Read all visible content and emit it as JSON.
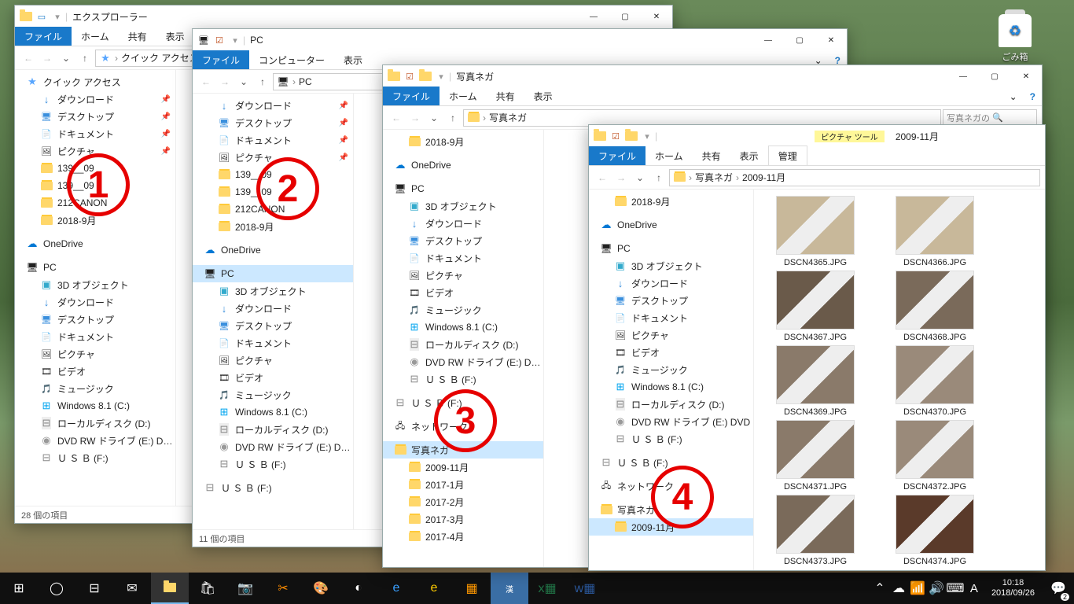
{
  "desktop": {
    "recycle_bin": "ごみ箱"
  },
  "overlay": {
    "1": "1",
    "2": "2",
    "3": "3",
    "4": "4"
  },
  "titlebar_title_extra": "2009-11月",
  "tabs": {
    "file": "ファイル",
    "home": "ホーム",
    "share": "共有",
    "view": "表示",
    "computer": "コンピューター",
    "tool_ctx": "ピクチャ ツール",
    "tool_manage": "管理"
  },
  "ui": {
    "search_prefix": "写真ネガの"
  },
  "w1": {
    "title": "エクスプローラー",
    "breadcrumb": [
      "クイック アクセス"
    ],
    "status": "28 個の項目",
    "nav": [
      {
        "lbl": "クイック アクセス",
        "ico": "i-star",
        "ind": 0
      },
      {
        "lbl": "ダウンロード",
        "ico": "i-dl",
        "ind": 1,
        "pin": 1
      },
      {
        "lbl": "デスクトップ",
        "ico": "i-desk",
        "ind": 1,
        "pin": 1
      },
      {
        "lbl": "ドキュメント",
        "ico": "i-doc",
        "ind": 1,
        "pin": 1
      },
      {
        "lbl": "ピクチャ",
        "ico": "i-pic",
        "ind": 1,
        "pin": 1
      },
      {
        "lbl": "139__09",
        "ico": "i-fold",
        "ind": 1
      },
      {
        "lbl": "139__09",
        "ico": "i-fold",
        "ind": 1
      },
      {
        "lbl": "212CANON",
        "ico": "i-fold",
        "ind": 1
      },
      {
        "lbl": "2018-9月",
        "ico": "i-fold",
        "ind": 1
      },
      {
        "lbl": "",
        "spacer": 1
      },
      {
        "lbl": "OneDrive",
        "ico": "i-od",
        "ind": 0
      },
      {
        "lbl": "",
        "spacer": 1
      },
      {
        "lbl": "PC",
        "ico": "i-pc",
        "ind": 0
      },
      {
        "lbl": "3D オブジェクト",
        "ico": "i-3d",
        "ind": 1
      },
      {
        "lbl": "ダウンロード",
        "ico": "i-dl",
        "ind": 1
      },
      {
        "lbl": "デスクトップ",
        "ico": "i-desk",
        "ind": 1
      },
      {
        "lbl": "ドキュメント",
        "ico": "i-doc",
        "ind": 1
      },
      {
        "lbl": "ピクチャ",
        "ico": "i-pic",
        "ind": 1
      },
      {
        "lbl": "ビデオ",
        "ico": "i-vid",
        "ind": 1
      },
      {
        "lbl": "ミュージック",
        "ico": "i-mus",
        "ind": 1
      },
      {
        "lbl": "Windows 8.1 (C:)",
        "ico": "i-win",
        "ind": 1
      },
      {
        "lbl": "ローカルディスク (D:)",
        "ico": "i-drive",
        "ind": 1
      },
      {
        "lbl": "DVD RW ドライブ (E:) DVD",
        "ico": "i-dvd",
        "ind": 1
      },
      {
        "lbl": "Ｕ Ｓ Ｂ (F:)",
        "ico": "i-usb",
        "ind": 1
      }
    ]
  },
  "w2": {
    "title": "PC",
    "breadcrumb": [
      "PC"
    ],
    "status": "11 個の項目",
    "nav": [
      {
        "lbl": "ダウンロード",
        "ico": "i-dl",
        "ind": 1,
        "pin": 1
      },
      {
        "lbl": "デスクトップ",
        "ico": "i-desk",
        "ind": 1,
        "pin": 1
      },
      {
        "lbl": "ドキュメント",
        "ico": "i-doc",
        "ind": 1,
        "pin": 1
      },
      {
        "lbl": "ピクチャ",
        "ico": "i-pic",
        "ind": 1,
        "pin": 1
      },
      {
        "lbl": "139__09",
        "ico": "i-fold",
        "ind": 1
      },
      {
        "lbl": "139__09",
        "ico": "i-fold",
        "ind": 1
      },
      {
        "lbl": "212CANON",
        "ico": "i-fold",
        "ind": 1
      },
      {
        "lbl": "2018-9月",
        "ico": "i-fold",
        "ind": 1
      },
      {
        "lbl": "",
        "spacer": 1
      },
      {
        "lbl": "OneDrive",
        "ico": "i-od",
        "ind": 0
      },
      {
        "lbl": "",
        "spacer": 1
      },
      {
        "lbl": "PC",
        "ico": "i-pc",
        "ind": 0,
        "sel": 1
      },
      {
        "lbl": "3D オブジェクト",
        "ico": "i-3d",
        "ind": 1
      },
      {
        "lbl": "ダウンロード",
        "ico": "i-dl",
        "ind": 1
      },
      {
        "lbl": "デスクトップ",
        "ico": "i-desk",
        "ind": 1
      },
      {
        "lbl": "ドキュメント",
        "ico": "i-doc",
        "ind": 1
      },
      {
        "lbl": "ピクチャ",
        "ico": "i-pic",
        "ind": 1
      },
      {
        "lbl": "ビデオ",
        "ico": "i-vid",
        "ind": 1
      },
      {
        "lbl": "ミュージック",
        "ico": "i-mus",
        "ind": 1
      },
      {
        "lbl": "Windows 8.1 (C:)",
        "ico": "i-win",
        "ind": 1
      },
      {
        "lbl": "ローカルディスク (D:)",
        "ico": "i-drive",
        "ind": 1
      },
      {
        "lbl": "DVD RW ドライブ (E:) DVD",
        "ico": "i-dvd",
        "ind": 1
      },
      {
        "lbl": "Ｕ Ｓ Ｂ (F:)",
        "ico": "i-usb",
        "ind": 1
      },
      {
        "lbl": "",
        "spacer": 1
      },
      {
        "lbl": "Ｕ Ｓ Ｂ (F:)",
        "ico": "i-usb",
        "ind": 0
      }
    ]
  },
  "w3": {
    "title": "写真ネガ",
    "breadcrumb": [
      "写真ネガ"
    ],
    "status": "",
    "nav": [
      {
        "lbl": "2018-9月",
        "ico": "i-fold",
        "ind": 1
      },
      {
        "lbl": "",
        "spacer": 1
      },
      {
        "lbl": "OneDrive",
        "ico": "i-od",
        "ind": 0
      },
      {
        "lbl": "",
        "spacer": 1
      },
      {
        "lbl": "PC",
        "ico": "i-pc",
        "ind": 0
      },
      {
        "lbl": "3D オブジェクト",
        "ico": "i-3d",
        "ind": 1
      },
      {
        "lbl": "ダウンロード",
        "ico": "i-dl",
        "ind": 1
      },
      {
        "lbl": "デスクトップ",
        "ico": "i-desk",
        "ind": 1
      },
      {
        "lbl": "ドキュメント",
        "ico": "i-doc",
        "ind": 1
      },
      {
        "lbl": "ピクチャ",
        "ico": "i-pic",
        "ind": 1
      },
      {
        "lbl": "ビデオ",
        "ico": "i-vid",
        "ind": 1
      },
      {
        "lbl": "ミュージック",
        "ico": "i-mus",
        "ind": 1
      },
      {
        "lbl": "Windows 8.1 (C:)",
        "ico": "i-win",
        "ind": 1
      },
      {
        "lbl": "ローカルディスク (D:)",
        "ico": "i-drive",
        "ind": 1
      },
      {
        "lbl": "DVD RW ドライブ (E:) DVD",
        "ico": "i-dvd",
        "ind": 1
      },
      {
        "lbl": "Ｕ Ｓ Ｂ (F:)",
        "ico": "i-usb",
        "ind": 1
      },
      {
        "lbl": "",
        "spacer": 1
      },
      {
        "lbl": "Ｕ Ｓ Ｂ (F:)",
        "ico": "i-usb",
        "ind": 0
      },
      {
        "lbl": "",
        "spacer": 1
      },
      {
        "lbl": "ネットワーク",
        "ico": "i-net",
        "ind": 0
      },
      {
        "lbl": "",
        "spacer": 1
      },
      {
        "lbl": "写真ネガ",
        "ico": "i-fold",
        "ind": 0,
        "sel": 1
      },
      {
        "lbl": "2009-11月",
        "ico": "i-fold",
        "ind": 1
      },
      {
        "lbl": "2017-1月",
        "ico": "i-fold",
        "ind": 1
      },
      {
        "lbl": "2017-2月",
        "ico": "i-fold",
        "ind": 1
      },
      {
        "lbl": "2017-3月",
        "ico": "i-fold",
        "ind": 1
      },
      {
        "lbl": "2017-4月",
        "ico": "i-fold",
        "ind": 1
      }
    ]
  },
  "w4": {
    "title": "2009-11月",
    "breadcrumb": [
      "写真ネガ",
      "2009-11月"
    ],
    "status": "",
    "nav": [
      {
        "lbl": "2018-9月",
        "ico": "i-fold",
        "ind": 1
      },
      {
        "lbl": "",
        "spacer": 1
      },
      {
        "lbl": "OneDrive",
        "ico": "i-od",
        "ind": 0
      },
      {
        "lbl": "",
        "spacer": 1
      },
      {
        "lbl": "PC",
        "ico": "i-pc",
        "ind": 0
      },
      {
        "lbl": "3D オブジェクト",
        "ico": "i-3d",
        "ind": 1
      },
      {
        "lbl": "ダウンロード",
        "ico": "i-dl",
        "ind": 1
      },
      {
        "lbl": "デスクトップ",
        "ico": "i-desk",
        "ind": 1
      },
      {
        "lbl": "ドキュメント",
        "ico": "i-doc",
        "ind": 1
      },
      {
        "lbl": "ピクチャ",
        "ico": "i-pic",
        "ind": 1
      },
      {
        "lbl": "ビデオ",
        "ico": "i-vid",
        "ind": 1
      },
      {
        "lbl": "ミュージック",
        "ico": "i-mus",
        "ind": 1
      },
      {
        "lbl": "Windows 8.1 (C:)",
        "ico": "i-win",
        "ind": 1
      },
      {
        "lbl": "ローカルディスク (D:)",
        "ico": "i-drive",
        "ind": 1
      },
      {
        "lbl": "DVD RW ドライブ (E:) DVD",
        "ico": "i-dvd",
        "ind": 1
      },
      {
        "lbl": "Ｕ Ｓ Ｂ (F:)",
        "ico": "i-usb",
        "ind": 1
      },
      {
        "lbl": "",
        "spacer": 1
      },
      {
        "lbl": "Ｕ Ｓ Ｂ (F:)",
        "ico": "i-usb",
        "ind": 0
      },
      {
        "lbl": "",
        "spacer": 1
      },
      {
        "lbl": "ネットワーク",
        "ico": "i-net",
        "ind": 0
      },
      {
        "lbl": "",
        "spacer": 1
      },
      {
        "lbl": "写真ネガ",
        "ico": "i-fold",
        "ind": 0
      },
      {
        "lbl": "2009-11月",
        "ico": "i-fold",
        "ind": 1,
        "sel": 1
      }
    ],
    "thumbs": [
      {
        "name": "DSCN4365.JPG",
        "bg": "#c8b89a"
      },
      {
        "name": "DSCN4366.JPG",
        "bg": "#c8b89a"
      },
      {
        "name": "DSCN4367.JPG",
        "bg": "#6a5a4a"
      },
      {
        "name": "DSCN4368.JPG",
        "bg": "#7a6a5a"
      },
      {
        "name": "DSCN4369.JPG",
        "bg": "#8a7a6a"
      },
      {
        "name": "DSCN4370.JPG",
        "bg": "#9a8a7a"
      },
      {
        "name": "DSCN4371.JPG",
        "bg": "#8a7a6a"
      },
      {
        "name": "DSCN4372.JPG",
        "bg": "#9a8a7a"
      },
      {
        "name": "DSCN4373.JPG",
        "bg": "#7a6a5a"
      },
      {
        "name": "DSCN4374.JPG",
        "bg": "#5a3a2a"
      }
    ]
  },
  "taskbar": {
    "time": "10:18",
    "date": "2018/09/26",
    "ime": "A",
    "badge": "2"
  }
}
